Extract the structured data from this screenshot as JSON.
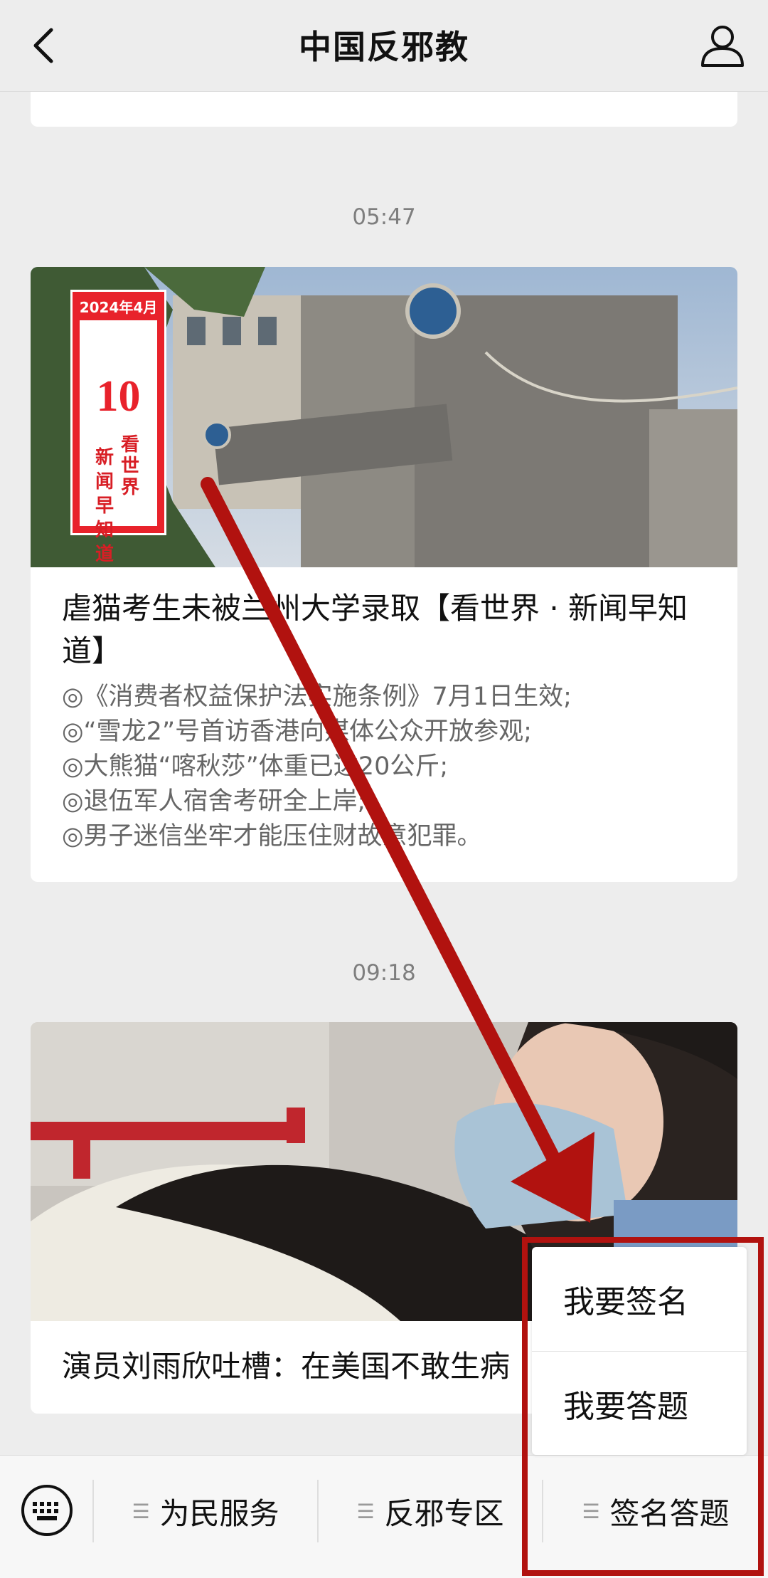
{
  "header": {
    "title": "中国反邪教",
    "back_icon": "chevron-left-icon",
    "profile_icon": "person-icon"
  },
  "timestamps": [
    "05:47",
    "09:18"
  ],
  "article1": {
    "badge": {
      "date": "2024年4月",
      "day": "10",
      "tag_right": "看世界",
      "tag_left": "新闻早知道"
    },
    "title": "虐猫考生未被兰州大学录取【看世界 · 新闻早知道】",
    "digest": [
      "◎《消费者权益保护法实施条例》7月1日生效;",
      "◎“雪龙2”号首访香港向媒体公众开放参观;",
      "◎大熊猫“喀秋莎”体重已达20公斤;",
      "◎退伍军人宿舍考研全上岸;",
      "◎男子迷信坐牢才能压住财故意犯罪。"
    ]
  },
  "article2": {
    "title": "演员刘雨欣吐槽：在美国不敢生病"
  },
  "bottom_menu": {
    "keyboard_icon": "keyboard-icon",
    "items": [
      "为民服务",
      "反邪专区",
      "签名答题"
    ]
  },
  "popup_menu": {
    "options": [
      "我要签名",
      "我要答题"
    ]
  },
  "colors": {
    "annotation_red": "#b1120f",
    "badge_red": "#e8222b",
    "background": "#ededed"
  }
}
